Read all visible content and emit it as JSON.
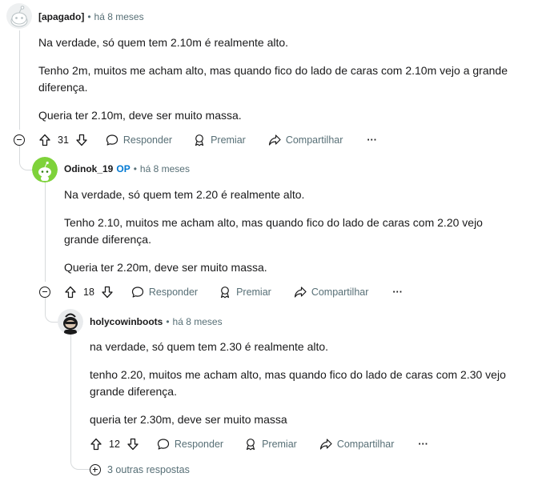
{
  "comments": [
    {
      "author": "[apagado]",
      "op_badge": "",
      "time": "há 8 meses",
      "paragraphs": [
        "Na verdade, só quem tem 2.10m é realmente alto.",
        "Tenho 2m, muitos me acham alto, mas quando fico do lado de caras com 2.10m vejo a grande diferença.",
        "Queria ter 2.10m, deve ser muito massa."
      ],
      "votes": "31"
    },
    {
      "author": "Odinok_19",
      "op_badge": "OP",
      "time": "há 8 meses",
      "paragraphs": [
        "Na verdade, só quem tem 2.20 é realmente alto.",
        "Tenho 2.10, muitos me acham alto, mas quando fico do lado de caras com 2.20 vejo grande diferença.",
        "Queria ter 2.20m, deve ser muito massa."
      ],
      "votes": "18"
    },
    {
      "author": "holycowinboots",
      "op_badge": "",
      "time": "há 8 meses",
      "paragraphs": [
        "na verdade, só quem tem 2.30 é realmente alto.",
        "tenho 2.20, muitos me acham alto, mas quando fico do lado de caras com 2.30 vejo grande diferença.",
        "queria ter 2.30m, deve ser muito massa"
      ],
      "votes": "12"
    }
  ],
  "actions": {
    "reply": "Responder",
    "award": "Premiar",
    "share": "Compartilhar",
    "overflow": "···"
  },
  "more_replies": "3 outras respostas",
  "colors": {
    "text": "#1a1a1b",
    "meta": "#576f76",
    "op": "#0079d3",
    "thread_line": "#d7dadc",
    "avatar_green": "#7ed23a"
  },
  "icons": [
    "reddit-snoo-icon",
    "upvote-icon",
    "downvote-icon",
    "reply-icon",
    "award-icon",
    "share-icon",
    "overflow-icon",
    "collapse-icon",
    "expand-icon"
  ]
}
